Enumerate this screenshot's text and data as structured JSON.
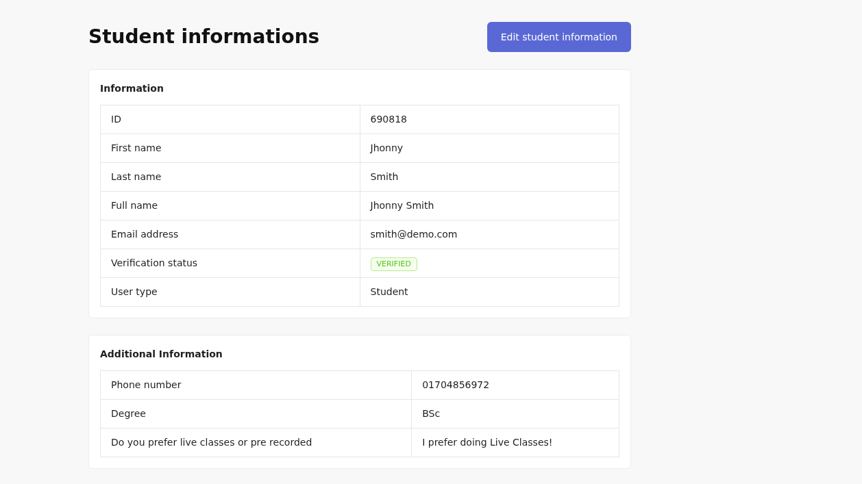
{
  "title": "Student informations",
  "edit_button": "Edit student information",
  "sections": [
    {
      "title": "Information",
      "rows": [
        {
          "label": "ID",
          "value": "690818",
          "kind": "text"
        },
        {
          "label": "First name",
          "value": "Jhonny",
          "kind": "text"
        },
        {
          "label": "Last name",
          "value": "Smith",
          "kind": "text"
        },
        {
          "label": "Full name",
          "value": "Jhonny Smith",
          "kind": "text"
        },
        {
          "label": "Email address",
          "value": "smith@demo.com",
          "kind": "text"
        },
        {
          "label": "Verification status",
          "value": "VERIFIED",
          "kind": "badge"
        },
        {
          "label": "User type",
          "value": "Student",
          "kind": "text"
        }
      ]
    },
    {
      "title": "Additional Information",
      "rows": [
        {
          "label": "Phone number",
          "value": "01704856972",
          "kind": "text"
        },
        {
          "label": "Degree",
          "value": "BSc",
          "kind": "text"
        },
        {
          "label": "Do you prefer live classes or pre recorded",
          "value": "I prefer doing Live Classes!",
          "kind": "text"
        }
      ]
    }
  ]
}
